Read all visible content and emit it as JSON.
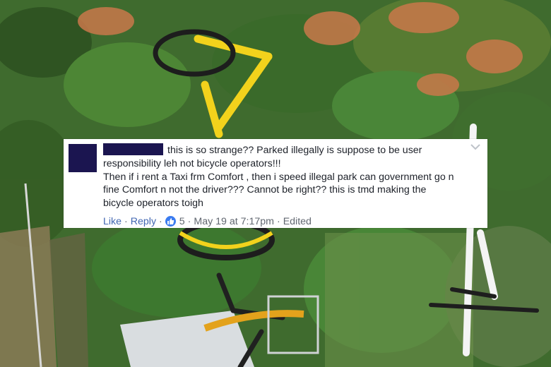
{
  "comment": {
    "line1": "this is so strange?? Parked illegally is suppose to be user",
    "line2": "responsibility leh not bicycle operators!!!",
    "line3": "Then if i rent a Taxi frm Comfort , then i speed illegal park can government go n",
    "line4": "fine Comfort n not the driver??? Cannot be right?? this is tmd making the",
    "line5": "bicycle operators toigh",
    "like_label": "Like",
    "reply_label": "Reply",
    "reaction_count": "5",
    "timestamp": "May 19 at 7:17pm",
    "edited_label": "Edited",
    "separator": "·"
  },
  "colors": {
    "link": "#4267b2",
    "meta": "#616770",
    "redaction": "#1b1550",
    "like_badge": "#3b7cf0"
  },
  "icons": [
    "chevron-down-icon",
    "thumbs-up-icon"
  ]
}
